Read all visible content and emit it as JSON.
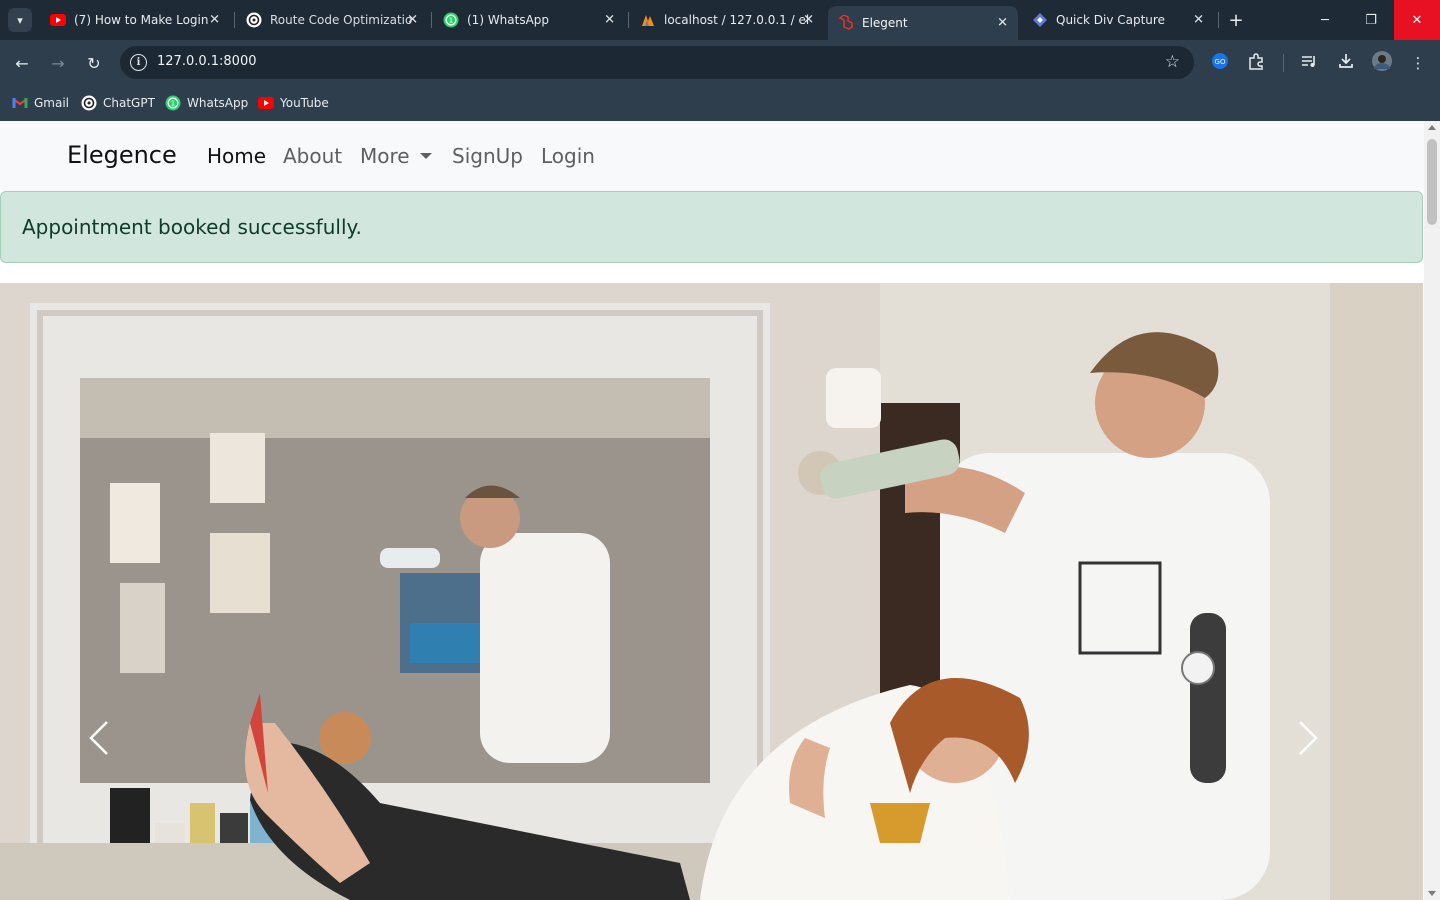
{
  "browser": {
    "tabs": [
      {
        "title": "(7) How to Make Login",
        "icon": "youtube-icon",
        "active": false
      },
      {
        "title": "Route Code Optimizatio",
        "icon": "chatgpt-icon",
        "active": false
      },
      {
        "title": "(1) WhatsApp",
        "icon": "whatsapp-icon",
        "active": false
      },
      {
        "title": "localhost / 127.0.0.1 / el",
        "icon": "phpmyadmin-icon",
        "active": false
      },
      {
        "title": "Elegent",
        "icon": "laravel-icon",
        "active": true
      },
      {
        "title": "Quick Div Capture",
        "icon": "extension-diamond-icon",
        "active": false
      }
    ],
    "address": {
      "url": "127.0.0.1:8000"
    },
    "bookmarks": [
      {
        "label": "Gmail",
        "icon": "gmail-icon"
      },
      {
        "label": "ChatGPT",
        "icon": "chatgpt-icon"
      },
      {
        "label": "WhatsApp",
        "icon": "whatsapp-icon"
      },
      {
        "label": "YouTube",
        "icon": "youtube-icon"
      }
    ],
    "colors": {
      "frame": "#1e2a36",
      "toolbar": "#2f3e4c",
      "close_window": "#e81123"
    }
  },
  "site": {
    "brand": "Elegence",
    "nav": {
      "home": "Home",
      "about": "About",
      "more": "More",
      "signup": "SignUp",
      "login": "Login"
    },
    "alert": {
      "message": "Appointment booked successfully.",
      "color": "#d1e7dd"
    },
    "carousel": {
      "image": "salon-hairdresser-styling-client-photo",
      "prev": "chevron-left-icon",
      "next": "chevron-right-icon"
    }
  }
}
